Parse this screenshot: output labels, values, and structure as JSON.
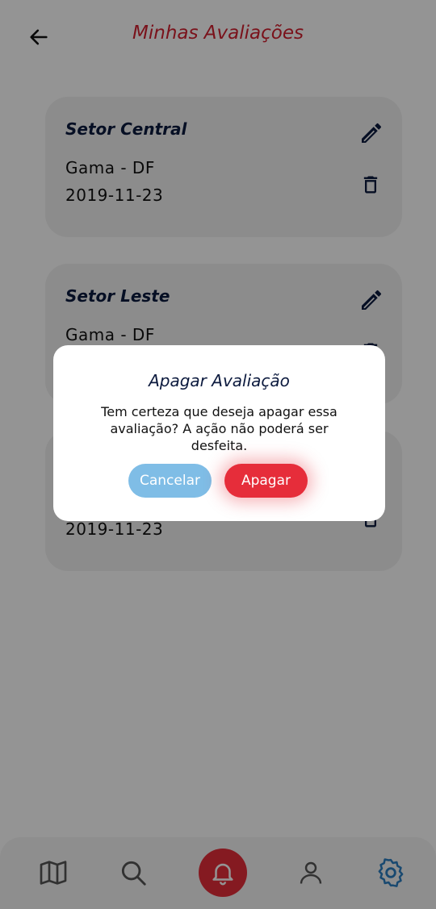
{
  "header": {
    "title": "Minhas Avaliações",
    "back_icon": "arrow-left-icon"
  },
  "cards": [
    {
      "title": "Setor Central",
      "location": "Gama - DF",
      "date": "2019-11-23"
    },
    {
      "title": "Setor Leste",
      "location": "Gama - DF",
      "date": ""
    },
    {
      "title": "",
      "location": "",
      "date": "2019-11-23"
    }
  ],
  "dialog": {
    "title": "Apagar Avaliação",
    "message": "Tem certeza que deseja apagar essa avaliação? A ação não poderá ser desfeita.",
    "cancel_label": "Cancelar",
    "confirm_label": "Apagar"
  },
  "nav": {
    "items": [
      "map-icon",
      "search-icon",
      "bell-icon",
      "user-icon",
      "gear-icon"
    ],
    "active": "gear-icon"
  },
  "colors": {
    "title": "#d32030",
    "primary_red": "#e62d3a",
    "cancel_blue": "#7fbde6",
    "navy": "#0c1a3e",
    "active_nav": "#2c7fc2"
  }
}
